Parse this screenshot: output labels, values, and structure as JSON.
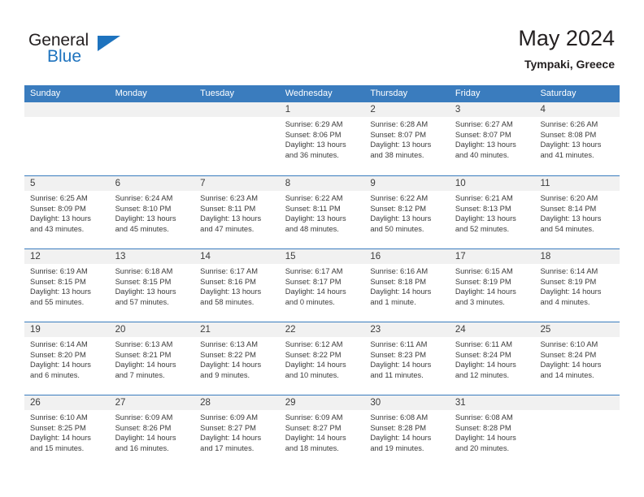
{
  "brand": {
    "name_part1": "General",
    "name_part2": "Blue",
    "triangle_icon": "triangle-icon",
    "color_primary": "#1e73be",
    "color_text": "#231f20"
  },
  "header": {
    "title": "May 2024",
    "subtitle": "Tympaki, Greece"
  },
  "theme": {
    "header_blue": "#3a7cbe",
    "day_strip_gray": "#f1f1f1",
    "text_gray": "#3b3b3b"
  },
  "weekdays": [
    "Sunday",
    "Monday",
    "Tuesday",
    "Wednesday",
    "Thursday",
    "Friday",
    "Saturday"
  ],
  "weeks": [
    [
      {
        "day": "",
        "empty": true,
        "lines": []
      },
      {
        "day": "",
        "empty": true,
        "lines": []
      },
      {
        "day": "",
        "empty": true,
        "lines": []
      },
      {
        "day": "1",
        "lines": [
          "Sunrise: 6:29 AM",
          "Sunset: 8:06 PM",
          "Daylight: 13 hours",
          "and 36 minutes."
        ]
      },
      {
        "day": "2",
        "lines": [
          "Sunrise: 6:28 AM",
          "Sunset: 8:07 PM",
          "Daylight: 13 hours",
          "and 38 minutes."
        ]
      },
      {
        "day": "3",
        "lines": [
          "Sunrise: 6:27 AM",
          "Sunset: 8:07 PM",
          "Daylight: 13 hours",
          "and 40 minutes."
        ]
      },
      {
        "day": "4",
        "lines": [
          "Sunrise: 6:26 AM",
          "Sunset: 8:08 PM",
          "Daylight: 13 hours",
          "and 41 minutes."
        ]
      }
    ],
    [
      {
        "day": "5",
        "lines": [
          "Sunrise: 6:25 AM",
          "Sunset: 8:09 PM",
          "Daylight: 13 hours",
          "and 43 minutes."
        ]
      },
      {
        "day": "6",
        "lines": [
          "Sunrise: 6:24 AM",
          "Sunset: 8:10 PM",
          "Daylight: 13 hours",
          "and 45 minutes."
        ]
      },
      {
        "day": "7",
        "lines": [
          "Sunrise: 6:23 AM",
          "Sunset: 8:11 PM",
          "Daylight: 13 hours",
          "and 47 minutes."
        ]
      },
      {
        "day": "8",
        "lines": [
          "Sunrise: 6:22 AM",
          "Sunset: 8:11 PM",
          "Daylight: 13 hours",
          "and 48 minutes."
        ]
      },
      {
        "day": "9",
        "lines": [
          "Sunrise: 6:22 AM",
          "Sunset: 8:12 PM",
          "Daylight: 13 hours",
          "and 50 minutes."
        ]
      },
      {
        "day": "10",
        "lines": [
          "Sunrise: 6:21 AM",
          "Sunset: 8:13 PM",
          "Daylight: 13 hours",
          "and 52 minutes."
        ]
      },
      {
        "day": "11",
        "lines": [
          "Sunrise: 6:20 AM",
          "Sunset: 8:14 PM",
          "Daylight: 13 hours",
          "and 54 minutes."
        ]
      }
    ],
    [
      {
        "day": "12",
        "lines": [
          "Sunrise: 6:19 AM",
          "Sunset: 8:15 PM",
          "Daylight: 13 hours",
          "and 55 minutes."
        ]
      },
      {
        "day": "13",
        "lines": [
          "Sunrise: 6:18 AM",
          "Sunset: 8:15 PM",
          "Daylight: 13 hours",
          "and 57 minutes."
        ]
      },
      {
        "day": "14",
        "lines": [
          "Sunrise: 6:17 AM",
          "Sunset: 8:16 PM",
          "Daylight: 13 hours",
          "and 58 minutes."
        ]
      },
      {
        "day": "15",
        "lines": [
          "Sunrise: 6:17 AM",
          "Sunset: 8:17 PM",
          "Daylight: 14 hours",
          "and 0 minutes."
        ]
      },
      {
        "day": "16",
        "lines": [
          "Sunrise: 6:16 AM",
          "Sunset: 8:18 PM",
          "Daylight: 14 hours",
          "and 1 minute."
        ]
      },
      {
        "day": "17",
        "lines": [
          "Sunrise: 6:15 AM",
          "Sunset: 8:19 PM",
          "Daylight: 14 hours",
          "and 3 minutes."
        ]
      },
      {
        "day": "18",
        "lines": [
          "Sunrise: 6:14 AM",
          "Sunset: 8:19 PM",
          "Daylight: 14 hours",
          "and 4 minutes."
        ]
      }
    ],
    [
      {
        "day": "19",
        "lines": [
          "Sunrise: 6:14 AM",
          "Sunset: 8:20 PM",
          "Daylight: 14 hours",
          "and 6 minutes."
        ]
      },
      {
        "day": "20",
        "lines": [
          "Sunrise: 6:13 AM",
          "Sunset: 8:21 PM",
          "Daylight: 14 hours",
          "and 7 minutes."
        ]
      },
      {
        "day": "21",
        "lines": [
          "Sunrise: 6:13 AM",
          "Sunset: 8:22 PM",
          "Daylight: 14 hours",
          "and 9 minutes."
        ]
      },
      {
        "day": "22",
        "lines": [
          "Sunrise: 6:12 AM",
          "Sunset: 8:22 PM",
          "Daylight: 14 hours",
          "and 10 minutes."
        ]
      },
      {
        "day": "23",
        "lines": [
          "Sunrise: 6:11 AM",
          "Sunset: 8:23 PM",
          "Daylight: 14 hours",
          "and 11 minutes."
        ]
      },
      {
        "day": "24",
        "lines": [
          "Sunrise: 6:11 AM",
          "Sunset: 8:24 PM",
          "Daylight: 14 hours",
          "and 12 minutes."
        ]
      },
      {
        "day": "25",
        "lines": [
          "Sunrise: 6:10 AM",
          "Sunset: 8:24 PM",
          "Daylight: 14 hours",
          "and 14 minutes."
        ]
      }
    ],
    [
      {
        "day": "26",
        "lines": [
          "Sunrise: 6:10 AM",
          "Sunset: 8:25 PM",
          "Daylight: 14 hours",
          "and 15 minutes."
        ]
      },
      {
        "day": "27",
        "lines": [
          "Sunrise: 6:09 AM",
          "Sunset: 8:26 PM",
          "Daylight: 14 hours",
          "and 16 minutes."
        ]
      },
      {
        "day": "28",
        "lines": [
          "Sunrise: 6:09 AM",
          "Sunset: 8:27 PM",
          "Daylight: 14 hours",
          "and 17 minutes."
        ]
      },
      {
        "day": "29",
        "lines": [
          "Sunrise: 6:09 AM",
          "Sunset: 8:27 PM",
          "Daylight: 14 hours",
          "and 18 minutes."
        ]
      },
      {
        "day": "30",
        "lines": [
          "Sunrise: 6:08 AM",
          "Sunset: 8:28 PM",
          "Daylight: 14 hours",
          "and 19 minutes."
        ]
      },
      {
        "day": "31",
        "lines": [
          "Sunrise: 6:08 AM",
          "Sunset: 8:28 PM",
          "Daylight: 14 hours",
          "and 20 minutes."
        ]
      },
      {
        "day": "",
        "empty": true,
        "lines": []
      }
    ]
  ]
}
